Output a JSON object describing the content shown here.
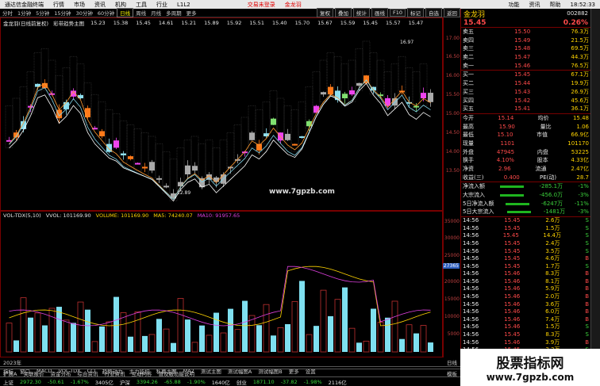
{
  "header": {
    "app": "通达信金融终端",
    "menus": [
      "行情",
      "市场",
      "资讯",
      "机构",
      "工具",
      "行业",
      "L1L2"
    ],
    "center": "交易未登录",
    "center2": "金龙羽",
    "right": [
      "功能",
      "资讯",
      "帮助"
    ],
    "time": "18:52:33"
  },
  "toolbar": {
    "periods": [
      "分时",
      "1分钟",
      "5分钟",
      "15分钟",
      "30分钟",
      "60分钟",
      "日线",
      "周线",
      "月线",
      "多周期",
      "更多"
    ],
    "active": "日线",
    "right": [
      "复权",
      "叠加",
      "统计",
      "画线",
      "F10",
      "标记",
      "自选",
      "返回"
    ]
  },
  "title": {
    "stock": "金龙羽(日线前复权)",
    "indicator": "彩带趋势主图",
    "prices": [
      "15.23",
      "15.38",
      "15.45",
      "14.61",
      "15.21",
      "15.89",
      "15.92",
      "15.51",
      "15.40",
      "15.70",
      "15.67",
      "15.59",
      "15.45",
      "15.57",
      "15.47"
    ]
  },
  "main_axis": [
    "17.00",
    "16.50",
    "16.00",
    "15.50",
    "15.00",
    "14.50",
    "14.00",
    "13.50"
  ],
  "annotations": {
    "high": "16.97",
    "low": "12.89",
    "watermark": "www.7gpzb.com"
  },
  "ind_title": {
    "name": "VOL-TDX(5,10)",
    "vvol": "VVOL: 101169.90",
    "volume": "VOLUME: 101169.90",
    "ma5": "MA5: 74240.07",
    "ma10": "MA10: 91957.65"
  },
  "ind_axis": [
    "35000",
    "30000",
    "25000",
    "20000",
    "15000",
    "10000",
    "5000"
  ],
  "ind_marker": "27365",
  "bottom": {
    "date": "2023年",
    "rows": [
      [
        "指标",
        "窗口",
        "MACD",
        "VOL-TDX",
        "CCI",
        "趋势动力",
        "主力监控",
        "私募主图",
        "MA2",
        "测试主图",
        "测试幅图A",
        "测试幅图B",
        "更多",
        "设置"
      ],
      [
        "扩展A",
        "关联报价",
        "资金分布",
        "综合资讯",
        "行业资讯",
        "互动问答",
        "普及版功能说明"
      ]
    ],
    "right": "模板",
    "day": "日线"
  },
  "status": [
    [
      "上证",
      "2972.30",
      "-50.61",
      "-1.67%",
      "3405亿"
    ],
    [
      "沪深",
      "3394.26",
      "-65.88",
      "-1.90%",
      "1640亿"
    ],
    [
      "创业",
      "1871.10",
      "-37.82",
      "-1.98%",
      "2116亿"
    ]
  ],
  "status_tail": "平安证券新疆行情",
  "panel": {
    "name": "金龙羽",
    "code": "002882",
    "price": "15.45",
    "chg": "0.26%",
    "asks": [
      [
        "卖五",
        "15.50",
        "76.3万"
      ],
      [
        "卖四",
        "15.49",
        "21.5万"
      ],
      [
        "卖三",
        "15.48",
        "69.5万"
      ],
      [
        "卖二",
        "15.47",
        "44.3万"
      ],
      [
        "卖一",
        "15.46",
        "76.5万"
      ]
    ],
    "bids": [
      [
        "买一",
        "15.45",
        "67.1万"
      ],
      [
        "买二",
        "15.44",
        "19.9万"
      ],
      [
        "买三",
        "15.43",
        "26.9万"
      ],
      [
        "买四",
        "15.42",
        "45.6万"
      ],
      [
        "买五",
        "15.41",
        "36.1万"
      ]
    ],
    "stats": [
      [
        "今开",
        "15.14",
        "均价",
        "15.48"
      ],
      [
        "最高",
        "15.90",
        "量比",
        "1.06"
      ],
      [
        "最低",
        "15.10",
        "市值",
        "66.9亿"
      ],
      [
        "现量",
        "1101",
        "",
        "101170"
      ],
      [
        "外盘",
        "47945",
        "内盘",
        "53225"
      ],
      [
        "换手",
        "4.10%",
        "股本",
        "4.33亿"
      ],
      [
        "净资",
        "2.96",
        "流通",
        "2.47亿"
      ],
      [
        "收益(三)",
        "0.400",
        "PE(动)",
        "28.7"
      ]
    ],
    "flows": [
      [
        "净流入额",
        "-285.1万",
        "-1%"
      ],
      [
        "大宗流入",
        "-456.0万",
        "-3%"
      ],
      [
        "5日净流入额",
        "-6247万",
        "-11%"
      ],
      [
        "5日大宗流入",
        "-1481万",
        "-3%"
      ]
    ],
    "ticks": [
      [
        "14:56",
        "15.45",
        "2.6万",
        "S"
      ],
      [
        "14:56",
        "15.45",
        "1.5万",
        "S"
      ],
      [
        "14:56",
        "15.45",
        "14.4万",
        "S"
      ],
      [
        "14:56",
        "15.45",
        "2.4万",
        "S"
      ],
      [
        "14:56",
        "15.45",
        "3.5万",
        "S"
      ],
      [
        "14:56",
        "15.45",
        "4.6万",
        "B"
      ],
      [
        "14:56",
        "15.45",
        "1.7万",
        "S"
      ],
      [
        "14:56",
        "15.46",
        "8.3万",
        "B"
      ],
      [
        "14:56",
        "15.46",
        "8.1万",
        "B"
      ],
      [
        "14:56",
        "15.46",
        "5.9万",
        "B"
      ],
      [
        "14:56",
        "15.46",
        "2.0万",
        "B"
      ],
      [
        "14:56",
        "15.46",
        "3.6万",
        "B"
      ],
      [
        "14:56",
        "15.46",
        "6.0万",
        "B"
      ],
      [
        "14:56",
        "15.46",
        "7.4万",
        "B"
      ],
      [
        "14:56",
        "15.46",
        "1.5万",
        "S"
      ],
      [
        "14:56",
        "15.45",
        "8.3万",
        "S"
      ],
      [
        "14:56",
        "15.46",
        "3.9万",
        "B"
      ],
      [
        "14:56",
        "15.45",
        "3.3万",
        "S"
      ],
      [
        "14:56",
        "15.45",
        "14.0万",
        "S"
      ],
      [
        "14:56",
        "15.45",
        "3.2万",
        "S"
      ]
    ]
  },
  "logo": {
    "line1": "股票指标网",
    "line2": "www.7gpzb.com"
  }
}
